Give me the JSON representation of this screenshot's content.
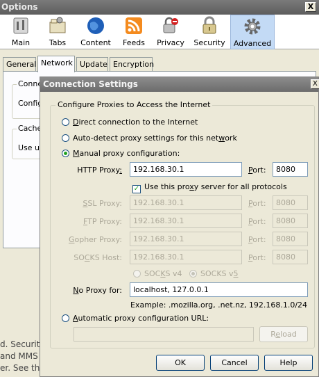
{
  "options_window": {
    "title": "Options",
    "close_glyph": "X",
    "toolbar": [
      {
        "label": "Main",
        "icon": "main-icon"
      },
      {
        "label": "Tabs",
        "icon": "tabs-icon"
      },
      {
        "label": "Content",
        "icon": "content-icon"
      },
      {
        "label": "Feeds",
        "icon": "feeds-icon"
      },
      {
        "label": "Privacy",
        "icon": "privacy-icon"
      },
      {
        "label": "Security",
        "icon": "security-icon"
      },
      {
        "label": "Advanced",
        "icon": "advanced-icon"
      }
    ],
    "tabs": [
      "General",
      "Network",
      "Update",
      "Encryption"
    ],
    "network_panel": {
      "connection_caption": "Conne",
      "configure_text": "Config",
      "cache_caption": "Cache",
      "use_text": "Use up"
    },
    "background_text": [
      "d. Securit",
      "and MMS",
      "er. See th"
    ]
  },
  "dialog": {
    "title": "Connection Settings",
    "close_glyph": "X",
    "group_caption": "Configure Proxies to Access the Internet",
    "options": {
      "direct": {
        "pre": "",
        "ul": "D",
        "post": "irect connection to the Internet"
      },
      "auto_detect": {
        "pre": "Auto-detect proxy settings for this net",
        "ul": "w",
        "post": "ork"
      },
      "manual": {
        "pre": "",
        "ul": "M",
        "post": "anual proxy configuration:"
      },
      "auto_url": {
        "pre": "",
        "ul": "A",
        "post": "utomatic proxy configuration URL:"
      }
    },
    "http_proxy": {
      "label_pre": "HTTP Proxy",
      "label_ul": ":",
      "value": "192.168.30.1",
      "port_ul": "P",
      "port_post": "ort:",
      "port": "8080"
    },
    "use_same_checkbox": {
      "pre": "Use this pro",
      "ul": "x",
      "post": "y server for all protocols"
    },
    "ssl_proxy": {
      "ul": "S",
      "post": "SL Proxy:",
      "value": "192.168.30.1",
      "port_ul": "P",
      "port_post": "ort:",
      "port": "8080"
    },
    "ftp_proxy": {
      "ul": "F",
      "post": "TP Proxy:",
      "value": "192.168.30.1",
      "port_ul": "P",
      "port_post": "ort:",
      "port": "8080"
    },
    "gopher_proxy": {
      "ul": "G",
      "post": "opher Proxy:",
      "value": "192.168.30.1",
      "port_ul": "P",
      "port_post": "ort:",
      "port": "8080"
    },
    "socks_host": {
      "pre": "SO",
      "ul": "C",
      "post": "KS Host:",
      "value": "192.168.30.1",
      "port_ul": "P",
      "port_post": "ort:",
      "port": "8080"
    },
    "socks_v4": {
      "pre": "SOC",
      "ul": "K",
      "post": "S v4"
    },
    "socks_v5": {
      "pre": "SOCKS v",
      "ul": "5",
      "post": ""
    },
    "no_proxy": {
      "ul": "N",
      "post": "o Proxy for:",
      "value": "localhost, 127.0.0.1"
    },
    "example": "Example: .mozilla.org, .net.nz, 192.168.1.0/24",
    "auto_url_value": "",
    "reload_pre": "R",
    "reload_ul": "e",
    "reload_post": "load",
    "buttons": {
      "ok": "OK",
      "cancel": "Cancel",
      "help": "Help"
    }
  }
}
